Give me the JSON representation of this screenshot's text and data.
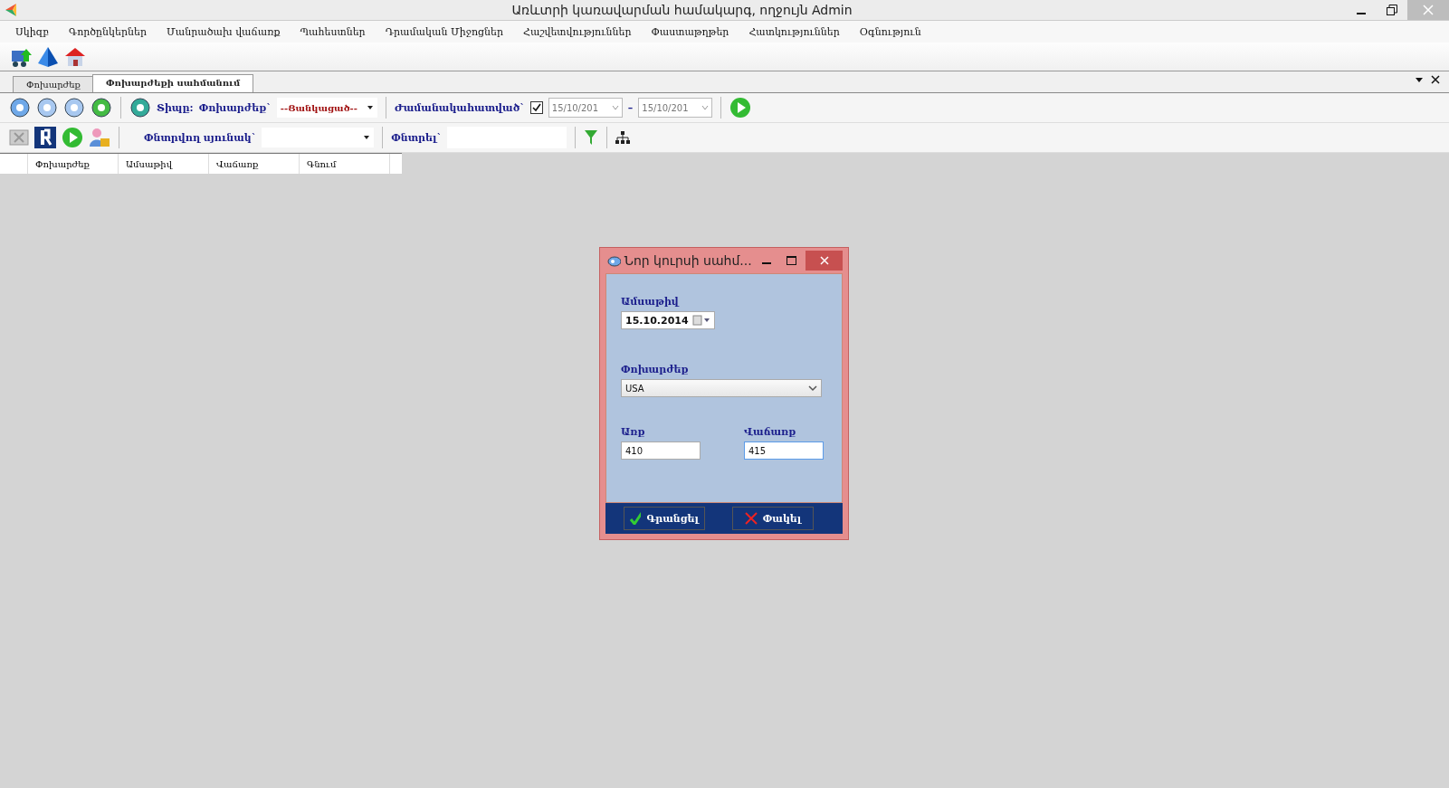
{
  "window": {
    "title": "Առևտրի կառավարման համակարգ, ողջույն Admin"
  },
  "menu": [
    "Սկիզբ",
    "Գործընկերներ",
    "Մանրածախ վաճառք",
    "Պահեստներ",
    "Դրամական Միջոցներ",
    "Հաշվետվություններ",
    "Փաստաթղթեր",
    "Հատկություններ",
    "Օգնություն"
  ],
  "tabs": [
    {
      "label": "Փոխարժեք",
      "selected": false
    },
    {
      "label": "Փոխարժեքի սահմանում",
      "selected": true
    }
  ],
  "filter": {
    "type_label": "Տիպը:",
    "currency_label": "Փոխարժեք`",
    "currency_value": "--Ցանկացած--",
    "period_label": "Ժամանակահատված`",
    "period_checked": true,
    "date_from": "15/10/201",
    "dash": "–",
    "date_to": "15/10/201"
  },
  "search": {
    "column_label": "Փնտրվող սյունակ`",
    "search_label": "Փնտրել`"
  },
  "table": {
    "columns": [
      "Փոխարժեք",
      "Ամսաթիվ",
      "Վաճառք",
      "Գնում"
    ]
  },
  "dialog": {
    "title": "Նոր կուրսի սահմ...",
    "date_label": "Ամսաթիվ",
    "date_value": "15.10.2014",
    "currency_label": "Փոխարժեք",
    "currency_value": "USA",
    "buy_label": "Առք",
    "buy_value": "410",
    "sell_label": "Վաճառք",
    "sell_value": "415",
    "save": "Գրանցել",
    "close": "Փակել"
  }
}
